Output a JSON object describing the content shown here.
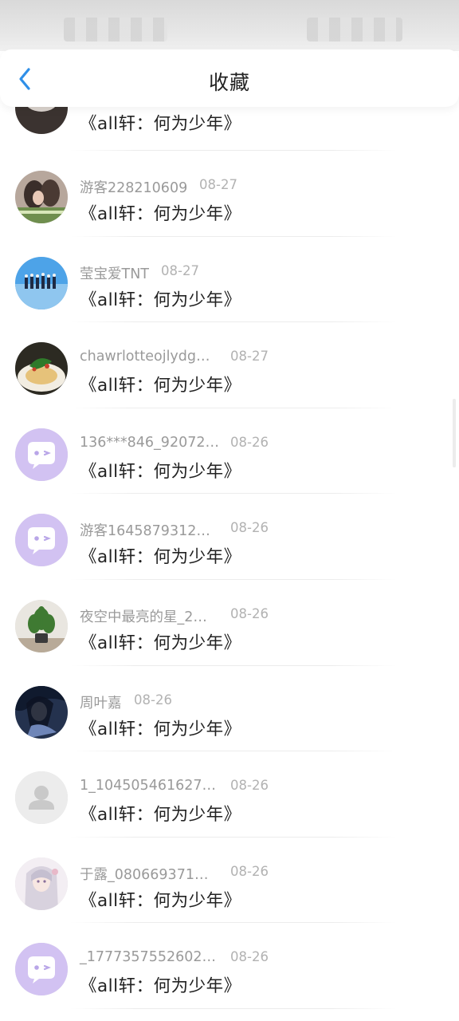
{
  "header": {
    "title": "收藏"
  },
  "items": [
    {
      "avatar": "photo-animal",
      "name": "",
      "date": "",
      "work": "《all轩：何为少年》"
    },
    {
      "avatar": "photo-couple",
      "name": "游客228210609",
      "date": "08-27",
      "work": "《all轩：何为少年》"
    },
    {
      "avatar": "photo-group",
      "name": "莹宝爱TNT",
      "date": "08-27",
      "work": "《all轩：何为少年》"
    },
    {
      "avatar": "photo-food",
      "name": "chawrlotteojlydg…",
      "date": "08-27",
      "work": "《all轩：何为少年》"
    },
    {
      "avatar": "default-chat",
      "name": "136***846_92072…",
      "date": "08-26",
      "work": "《all轩：何为少年》"
    },
    {
      "avatar": "default-chat",
      "name": "游客1645879312…",
      "date": "08-26",
      "work": "《all轩：何为少年》"
    },
    {
      "avatar": "photo-plant",
      "name": "夜空中最亮的星_2…",
      "date": "08-26",
      "work": "《all轩：何为少年》"
    },
    {
      "avatar": "photo-anime",
      "name": "周叶嘉",
      "date": "08-26",
      "work": "《all轩：何为少年》"
    },
    {
      "avatar": "default-person",
      "name": "1_104505461627…",
      "date": "08-26",
      "work": "《all轩：何为少年》"
    },
    {
      "avatar": "photo-girl",
      "name": "于露_080669371…",
      "date": "08-26",
      "work": "《all轩：何为少年》"
    },
    {
      "avatar": "default-chat",
      "name": "_1777357552602…",
      "date": "08-26",
      "work": "《all轩：何为少年》"
    }
  ],
  "colors": {
    "accent": "#2f8fe8",
    "chat_avatar_bg": "#d2c2f2",
    "text_primary": "#222222",
    "text_secondary": "#9a9a9a"
  }
}
